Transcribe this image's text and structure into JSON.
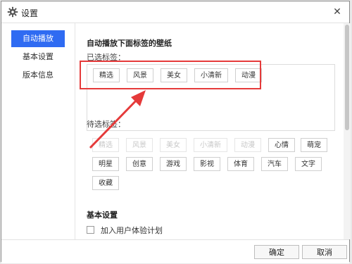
{
  "window": {
    "title": "设置",
    "icon": "gear-icon",
    "close_glyph": "✕"
  },
  "sidebar": {
    "items": [
      {
        "label": "自动播放",
        "active": true
      },
      {
        "label": "基本设置",
        "active": false
      },
      {
        "label": "版本信息",
        "active": false
      }
    ]
  },
  "content": {
    "heading": "自动播放下面标签的壁纸",
    "selected_label": "已选标签：",
    "selected_tags": [
      "精选",
      "风景",
      "美女",
      "小清新",
      "动漫"
    ],
    "pending_label": "待选标签：",
    "pending_tags": [
      {
        "label": "精选",
        "disabled": true
      },
      {
        "label": "风景",
        "disabled": true
      },
      {
        "label": "美女",
        "disabled": true
      },
      {
        "label": "小清新",
        "disabled": true
      },
      {
        "label": "动漫",
        "disabled": true
      },
      {
        "label": "心情",
        "disabled": false
      },
      {
        "label": "萌宠",
        "disabled": false
      },
      {
        "label": "明星",
        "disabled": false
      },
      {
        "label": "创意",
        "disabled": false
      },
      {
        "label": "游戏",
        "disabled": false
      },
      {
        "label": "影视",
        "disabled": false
      },
      {
        "label": "体育",
        "disabled": false
      },
      {
        "label": "汽车",
        "disabled": false
      },
      {
        "label": "文字",
        "disabled": false
      },
      {
        "label": "收藏",
        "disabled": false
      }
    ],
    "basic_heading": "基本设置",
    "ux_plan_label": "加入用户体验计划",
    "ux_plan_checked": false
  },
  "footer": {
    "ok_label": "确定",
    "cancel_label": "取消"
  },
  "colors": {
    "accent": "#2f6bf2",
    "annotation": "#e53a3a"
  }
}
